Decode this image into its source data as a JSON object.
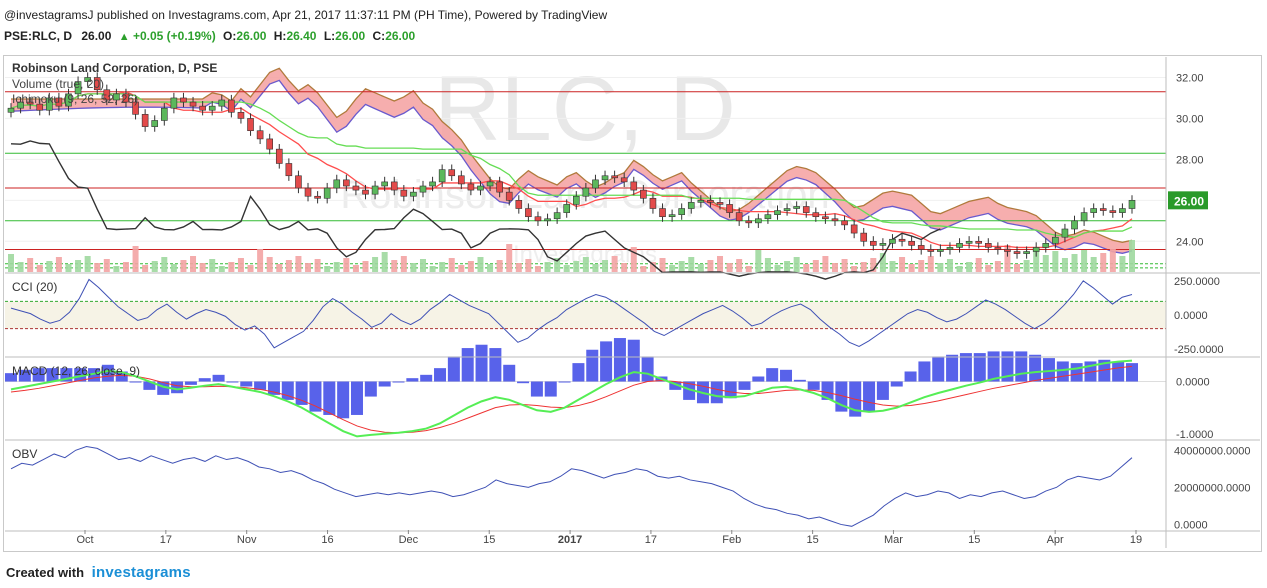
{
  "header": {
    "published_line": "@investagramsJ published on Investagrams.com, Apr 21, 2017 11:37:11 PM (PH Time), Powered by TradingView",
    "symbol": "PSE:RLC, D",
    "price": "26.00",
    "change_arrow": "▲",
    "change": "+0.05 (+0.19%)",
    "open_label": "O:",
    "open": "26.00",
    "high_label": "H:",
    "high": "26.40",
    "low_label": "L:",
    "low": "26.00",
    "close_label": "C:",
    "close": "26.00"
  },
  "watermark": {
    "big": "RLC, D",
    "sub": "Robinson Land Corporation",
    "source": "Investagrams"
  },
  "footer": {
    "created_with": "Created with",
    "brand": "investagrams"
  },
  "colors": {
    "up_candle": "#5cb85c",
    "down_candle": "#e34a4a",
    "cloud_fill": "#f4a0a0",
    "span_a": "#b07a3c",
    "span_b": "#6a5acd",
    "tenkan": "#ff4d4d",
    "kijun": "#66dd55",
    "chikou": "#333333",
    "cci_line": "#3f51b5",
    "macd_line": "#55ee55",
    "signal_line": "#ee3333",
    "hist": "#3b47e6",
    "obv_line": "#3f51b5",
    "current_price_badge": "#2a9a2a",
    "brand_blue": "#1b8fd6"
  },
  "chart_data": [
    {
      "type": "candlestick",
      "title": "Robinson Land Corporation, D, PSE",
      "indicators": [
        "Volume (true, 20)",
        "Ichimoku (9, 26, 52, 26)"
      ],
      "y_ticks": [
        "32.00",
        "30.00",
        "28.00",
        "26.00",
        "24.00"
      ],
      "ylim": [
        22.5,
        33.0
      ],
      "current_price_label": "26.00",
      "horizontal_lines": [
        {
          "value": 31.3,
          "color": "#cc2222"
        },
        {
          "value": 28.3,
          "color": "#33bb33"
        },
        {
          "value": 26.6,
          "color": "#cc2222"
        },
        {
          "value": 25.0,
          "color": "#33bb33"
        },
        {
          "value": 23.6,
          "color": "#cc2222"
        },
        {
          "value": 22.9,
          "color": "#33bb33",
          "dashed": true
        },
        {
          "value": 22.7,
          "color": "#33bb33",
          "dashed": true
        }
      ],
      "x_tick_labels": [
        "Oct",
        "17",
        "Nov",
        "16",
        "Dec",
        "15",
        "2017",
        "17",
        "Feb",
        "15",
        "Mar",
        "15",
        "Apr",
        "19"
      ],
      "closes": [
        30.5,
        30.8,
        30.7,
        30.4,
        31.0,
        30.6,
        31.2,
        31.8,
        32.0,
        31.4,
        30.9,
        31.2,
        30.8,
        30.2,
        29.6,
        29.9,
        30.5,
        31.0,
        30.8,
        30.6,
        30.4,
        30.6,
        30.9,
        30.3,
        30.0,
        29.4,
        29.0,
        28.5,
        27.8,
        27.2,
        26.6,
        26.2,
        26.1,
        26.6,
        27.0,
        26.7,
        26.5,
        26.3,
        26.7,
        26.9,
        26.5,
        26.2,
        26.4,
        26.7,
        26.9,
        27.5,
        27.2,
        26.8,
        26.5,
        26.7,
        26.9,
        26.4,
        26.0,
        25.6,
        25.2,
        25.0,
        25.1,
        25.4,
        25.8,
        26.2,
        26.6,
        27.0,
        27.2,
        27.1,
        26.9,
        26.5,
        26.1,
        25.6,
        25.2,
        25.3,
        25.6,
        25.9,
        26.0,
        25.9,
        25.8,
        25.4,
        25.0,
        24.9,
        25.1,
        25.3,
        25.5,
        25.6,
        25.7,
        25.4,
        25.2,
        25.1,
        25.0,
        24.8,
        24.4,
        24.0,
        23.8,
        23.9,
        24.1,
        24.0,
        23.8,
        23.6,
        23.5,
        23.6,
        23.7,
        23.9,
        24.0,
        23.9,
        23.7,
        23.6,
        23.5,
        23.4,
        23.5,
        23.7,
        23.9,
        24.2,
        24.6,
        25.0,
        25.4,
        25.6,
        25.5,
        25.4,
        25.6,
        26.0
      ]
    },
    {
      "type": "line",
      "title": "CCI (20)",
      "y_ticks": [
        "250.0000",
        "0.0000",
        "-250.0000"
      ],
      "ylim": [
        -300,
        300
      ],
      "values": [
        50,
        30,
        10,
        -30,
        -60,
        -40,
        20,
        120,
        260,
        200,
        130,
        60,
        10,
        -40,
        -20,
        40,
        80,
        20,
        -30,
        10,
        40,
        20,
        -10,
        -70,
        -110,
        -80,
        -140,
        -240,
        -200,
        -160,
        -120,
        -40,
        60,
        120,
        80,
        20,
        -30,
        -90,
        -60,
        10,
        -40,
        -70,
        -30,
        40,
        90,
        150,
        110,
        70,
        40,
        10,
        -60,
        -130,
        -200,
        -170,
        -110,
        -60,
        -20,
        40,
        80,
        120,
        150,
        130,
        90,
        40,
        -10,
        -60,
        -120,
        -150,
        -110,
        -70,
        -30,
        10,
        40,
        70,
        30,
        -20,
        -80,
        -60,
        -10,
        30,
        60,
        80,
        40,
        -30,
        -90,
        -140,
        -200,
        -230,
        -190,
        -140,
        -90,
        -40,
        10,
        40,
        20,
        -20,
        -50,
        -30,
        10,
        60,
        110,
        80,
        40,
        -10,
        -60,
        -100,
        -60,
        0,
        70,
        150,
        250,
        200,
        140,
        80,
        130,
        150
      ]
    },
    {
      "type": "line",
      "title": "MACD (12, 26, close, 9)",
      "y_ticks": [
        "0.0000",
        "-1.0000"
      ],
      "ylim": [
        -1.1,
        0.45
      ],
      "macd": [
        -0.15,
        -0.1,
        -0.05,
        0.0,
        0.05,
        0.1,
        0.15,
        0.2,
        0.18,
        0.1,
        0.0,
        -0.1,
        -0.15,
        -0.12,
        -0.08,
        -0.05,
        -0.1,
        -0.15,
        -0.2,
        -0.28,
        -0.38,
        -0.5,
        -0.65,
        -0.8,
        -0.95,
        -1.05,
        -1.02,
        -1.0,
        -0.98,
        -0.95,
        -0.9,
        -0.8,
        -0.65,
        -0.5,
        -0.38,
        -0.3,
        -0.35,
        -0.45,
        -0.55,
        -0.58,
        -0.5,
        -0.35,
        -0.2,
        -0.05,
        0.08,
        0.18,
        0.15,
        0.05,
        -0.05,
        -0.15,
        -0.22,
        -0.28,
        -0.3,
        -0.28,
        -0.2,
        -0.12,
        -0.1,
        -0.15,
        -0.22,
        -0.32,
        -0.45,
        -0.55,
        -0.58,
        -0.56,
        -0.5,
        -0.4,
        -0.3,
        -0.22,
        -0.15,
        -0.08,
        -0.02,
        0.05,
        0.1,
        0.15,
        0.18,
        0.2,
        0.22,
        0.25,
        0.3,
        0.35,
        0.38,
        0.4
      ],
      "signal": [
        -0.2,
        -0.17,
        -0.13,
        -0.08,
        -0.03,
        0.02,
        0.07,
        0.1,
        0.12,
        0.1,
        0.05,
        -0.02,
        -0.08,
        -0.1,
        -0.1,
        -0.09,
        -0.1,
        -0.12,
        -0.15,
        -0.2,
        -0.27,
        -0.36,
        -0.47,
        -0.6,
        -0.73,
        -0.85,
        -0.93,
        -0.97,
        -0.98,
        -0.97,
        -0.94,
        -0.88,
        -0.8,
        -0.7,
        -0.6,
        -0.5,
        -0.45,
        -0.44,
        -0.46,
        -0.49,
        -0.5,
        -0.46,
        -0.39,
        -0.29,
        -0.18,
        -0.07,
        0.0,
        0.02,
        0.0,
        -0.04,
        -0.09,
        -0.15,
        -0.2,
        -0.23,
        -0.23,
        -0.2,
        -0.17,
        -0.16,
        -0.17,
        -0.21,
        -0.27,
        -0.34,
        -0.4,
        -0.45,
        -0.47,
        -0.46,
        -0.42,
        -0.37,
        -0.31,
        -0.25,
        -0.19,
        -0.13,
        -0.08,
        -0.03,
        0.02,
        0.06,
        0.1,
        0.14,
        0.18,
        0.22,
        0.26,
        0.29
      ],
      "histogram": [
        0.05,
        0.07,
        0.08,
        0.08,
        0.08,
        0.08,
        0.08,
        0.1,
        0.06,
        0.0,
        -0.05,
        -0.08,
        -0.07,
        -0.02,
        0.02,
        0.04,
        0.0,
        -0.03,
        -0.05,
        -0.08,
        -0.11,
        -0.14,
        -0.18,
        -0.2,
        -0.22,
        -0.2,
        -0.09,
        -0.03,
        0.0,
        0.02,
        0.04,
        0.08,
        0.15,
        0.2,
        0.22,
        0.2,
        0.1,
        -0.01,
        -0.09,
        -0.09,
        0.0,
        0.11,
        0.19,
        0.24,
        0.26,
        0.25,
        0.15,
        0.03,
        -0.05,
        -0.11,
        -0.13,
        -0.13,
        -0.1,
        -0.05,
        0.03,
        0.08,
        0.07,
        0.01,
        -0.05,
        -0.11,
        -0.18,
        -0.21,
        -0.18,
        -0.11,
        -0.03,
        0.06,
        0.12,
        0.15,
        0.16,
        0.17,
        0.17,
        0.18,
        0.18,
        0.18,
        0.16,
        0.14,
        0.12,
        0.11,
        0.12,
        0.13,
        0.12,
        0.11
      ]
    },
    {
      "type": "line",
      "title": "OBV",
      "y_ticks": [
        "40000000.0000",
        "20000000.0000",
        "0.0000"
      ],
      "ylim": [
        -3000000,
        45000000
      ],
      "values": [
        30,
        33,
        32,
        35,
        38,
        36,
        40,
        42,
        41,
        38,
        35,
        36,
        34,
        37,
        35,
        33,
        35,
        36,
        34,
        37,
        35,
        36,
        34,
        31,
        30,
        28,
        29,
        27,
        24,
        22,
        19,
        17,
        15,
        16,
        17,
        16,
        17,
        16,
        17,
        18,
        17,
        15,
        16,
        18,
        20,
        24,
        22,
        21,
        20,
        22,
        23,
        26,
        30,
        29,
        27,
        25,
        27,
        28,
        30,
        29,
        26,
        25,
        26,
        24,
        23,
        22,
        20,
        18,
        14,
        11,
        9,
        8,
        6,
        5,
        3,
        4,
        2,
        0,
        -1,
        2,
        5,
        10,
        14,
        17,
        15,
        16,
        18,
        17,
        14,
        16,
        15,
        17,
        18,
        16,
        14,
        15,
        18,
        20,
        24,
        26,
        25,
        24,
        26,
        31,
        36
      ]
    }
  ]
}
